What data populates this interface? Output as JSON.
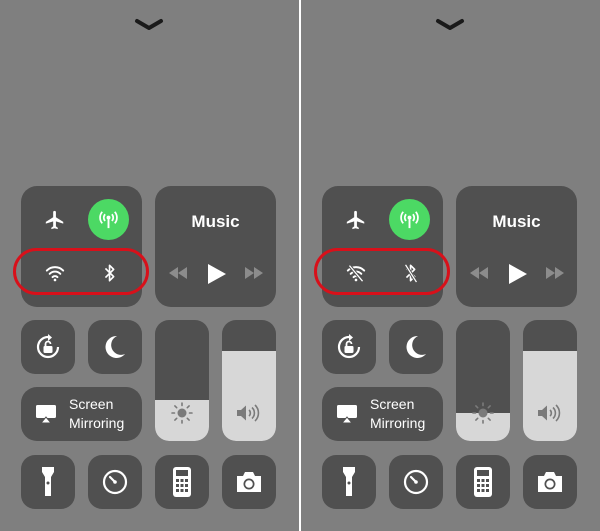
{
  "panels": [
    {
      "state": "before",
      "music": {
        "title": "Music"
      },
      "screen_mirroring": {
        "line1": "Screen",
        "line2": "Mirroring"
      },
      "wifi": {
        "enabled": true
      },
      "bluetooth": {
        "enabled": true
      },
      "cellular": {
        "enabled": true
      },
      "brightness_level": 0.34,
      "volume_level": 0.74
    },
    {
      "state": "after",
      "music": {
        "title": "Music"
      },
      "screen_mirroring": {
        "line1": "Screen",
        "line2": "Mirroring"
      },
      "wifi": {
        "enabled": false
      },
      "bluetooth": {
        "enabled": false
      },
      "cellular": {
        "enabled": true
      },
      "brightness_level": 0.23,
      "volume_level": 0.74
    }
  ],
  "colors": {
    "background": "#7f7f7f",
    "tile": "#505050",
    "cellular_active": "#4cd964",
    "slider_fill": "#d7d7d7",
    "highlight": "#d8101a"
  },
  "icons": [
    "chevron-down-icon",
    "airplane-icon",
    "cellular-antenna-icon",
    "wifi-icon",
    "bluetooth-icon",
    "rewind-icon",
    "play-icon",
    "fast-forward-icon",
    "rotation-lock-icon",
    "moon-icon",
    "airplay-icon",
    "sun-icon",
    "speaker-icon",
    "flashlight-icon",
    "timer-icon",
    "calculator-icon",
    "camera-icon"
  ]
}
